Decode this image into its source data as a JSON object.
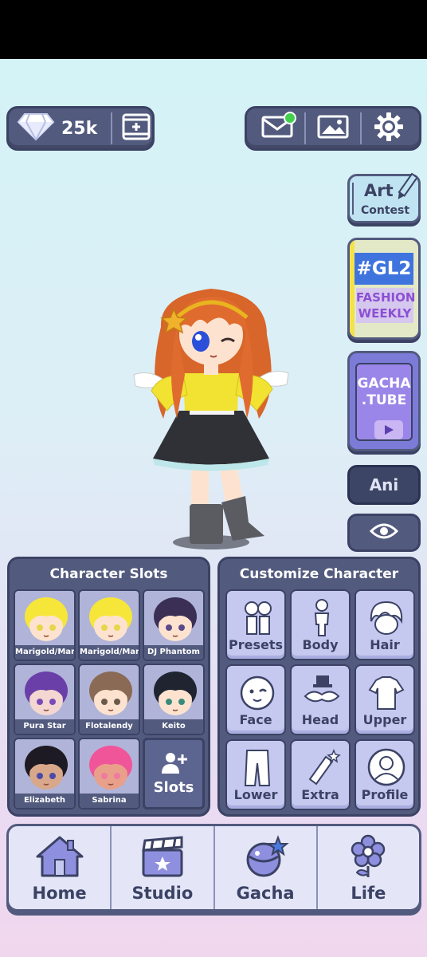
{
  "top_bar": {
    "gem_count": "25k",
    "icons": [
      "gem-icon",
      "add-video-icon",
      "mail-icon",
      "gallery-icon",
      "settings-icon"
    ]
  },
  "side_buttons": {
    "art_contest": {
      "line1": "Art",
      "line2": "Contest"
    },
    "fashion_weekly": {
      "hashtag": "#GL2",
      "line1": "FASHION",
      "line2": "WEEKLY"
    },
    "gacha_tube": {
      "line1": "GACHA",
      "line2": ".TUBE"
    },
    "ani_label": "Ani"
  },
  "character_slots": {
    "title": "Character Slots",
    "slots": [
      {
        "name": "Marigold/Mar",
        "hair": "#f7e63a",
        "skin": "#fde3cf",
        "eyes": "#e8d64a"
      },
      {
        "name": "Marigold/Mar",
        "hair": "#f7e63a",
        "skin": "#fde3cf",
        "eyes": "#e8d64a"
      },
      {
        "name": "DJ Phantom",
        "hair": "#3b2f55",
        "skin": "#fde3cf",
        "eyes": "#5b4a8a"
      },
      {
        "name": "Pura Star",
        "hair": "#6a3fa8",
        "skin": "#f3d7d0",
        "eyes": "#7a4ab8"
      },
      {
        "name": "Flotalendy",
        "hair": "#8a6a55",
        "skin": "#fde3cf",
        "eyes": "#6b5a4a"
      },
      {
        "name": "Keito",
        "hair": "#1f2430",
        "skin": "#fde3cf",
        "eyes": "#3a8a7a"
      },
      {
        "name": "Elizabeth",
        "hair": "#1e1a24",
        "skin": "#d9a88a",
        "eyes": "#4a4aa8"
      },
      {
        "name": "Sabrina",
        "hair": "#f0559a",
        "skin": "#e8a08a",
        "eyes": "#f07aa0"
      }
    ],
    "add_label": "Slots"
  },
  "customize": {
    "title": "Customize Character",
    "buttons": [
      {
        "label": "Presets",
        "icon": "presets-icon"
      },
      {
        "label": "Body",
        "icon": "body-icon"
      },
      {
        "label": "Hair",
        "icon": "hair-icon"
      },
      {
        "label": "Face",
        "icon": "face-icon"
      },
      {
        "label": "Head",
        "icon": "head-icon"
      },
      {
        "label": "Upper",
        "icon": "upper-icon"
      },
      {
        "label": "Lower",
        "icon": "lower-icon"
      },
      {
        "label": "Extra",
        "icon": "extra-icon"
      },
      {
        "label": "Profile",
        "icon": "profile-icon"
      }
    ]
  },
  "nav": {
    "items": [
      {
        "label": "Home",
        "icon": "home-icon"
      },
      {
        "label": "Studio",
        "icon": "clapperboard-icon"
      },
      {
        "label": "Gacha",
        "icon": "gacha-orb-icon"
      },
      {
        "label": "Life",
        "icon": "flower-icon"
      }
    ]
  },
  "colors": {
    "panel": "#525a7e",
    "panel_border": "#3b4264",
    "button_face": "#c5c8ef",
    "notification": "#43d04f"
  }
}
